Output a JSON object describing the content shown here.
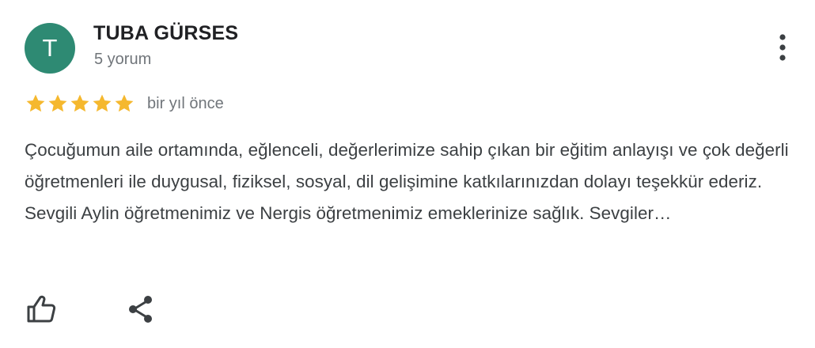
{
  "review": {
    "author": {
      "initial": "T",
      "name": "TUBA GÜRSES",
      "review_count": "5 yorum",
      "avatar_color": "#2e8a73"
    },
    "rating": {
      "stars": 5,
      "max": 5,
      "star_color": "#f5b82e"
    },
    "date": "bir yıl önce",
    "text": "Çocuğumun aile ortamında, eğlenceli, değerlerimize sahip çıkan bir eğitim anlayışı ve çok değerli öğretmenleri ile duygusal, fiziksel, sosyal, dil gelişimine katkılarınızdan dolayı teşekkür ederiz. Sevgili Aylin öğretmenimiz ve Nergis öğretmenimiz emeklerinize sağlık. Sevgiler…",
    "icons": {
      "more": "more-vert-icon",
      "like": "thumb-up-icon",
      "share": "share-icon"
    }
  }
}
